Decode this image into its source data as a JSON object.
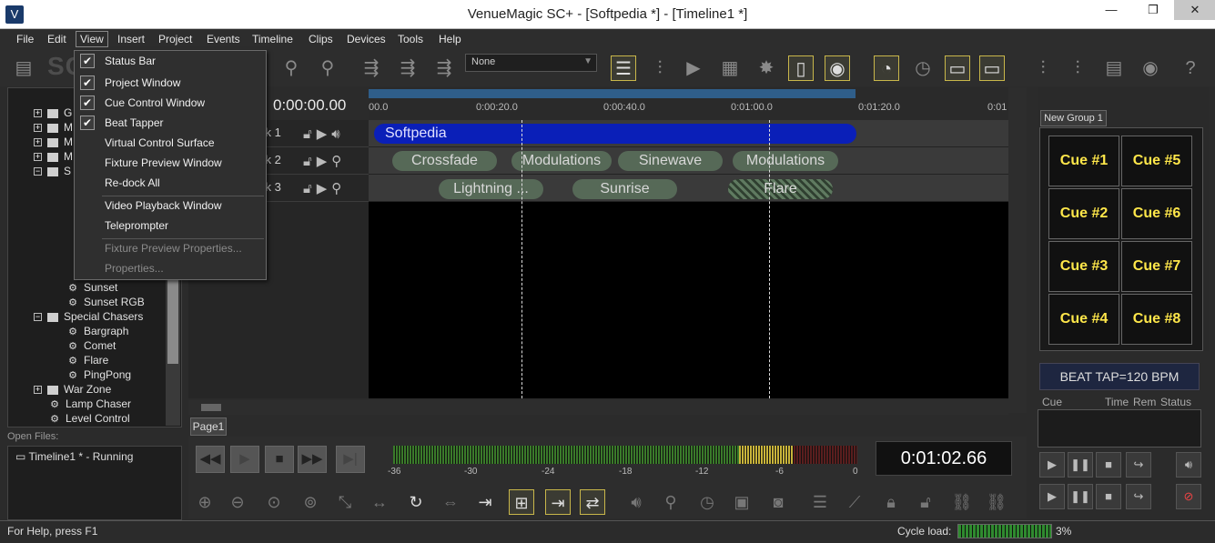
{
  "titlebar": {
    "title": "VenueMagic SC+ - [Softpedia *] - [Timeline1 *]",
    "minimize": "—",
    "restore": "❐",
    "close": "✕"
  },
  "menubar": [
    "File",
    "Edit",
    "View",
    "Insert",
    "Project",
    "Events",
    "Timeline",
    "Clips",
    "Devices",
    "Tools",
    "Help"
  ],
  "watermark": "SOFTPEDIA",
  "toolbar": {
    "select_value": "None"
  },
  "view_menu": {
    "items": [
      {
        "label": "Status Bar",
        "checked": true
      },
      {
        "label": "Project Window",
        "checked": true
      },
      {
        "label": "Cue Control Window",
        "checked": true
      },
      {
        "label": "Beat Tapper",
        "checked": true
      },
      {
        "label": "Virtual Control Surface"
      },
      {
        "label": "Fixture Preview Window"
      },
      {
        "label": "Re-dock All"
      },
      {
        "label": "Video Playback Window"
      },
      {
        "label": "Teleprompter"
      },
      {
        "label": "Fixture Preview Properties..."
      },
      {
        "label": "Properties..."
      }
    ]
  },
  "tree": {
    "items": [
      {
        "label": "G"
      },
      {
        "label": "M"
      },
      {
        "label": "M"
      },
      {
        "label": "M"
      },
      {
        "label": "S"
      },
      {
        "label": "Sunset"
      },
      {
        "label": "Sunset RGB"
      },
      {
        "label": "Special Chasers"
      },
      {
        "label": "Bargraph"
      },
      {
        "label": "Comet"
      },
      {
        "label": "Flare"
      },
      {
        "label": "PingPong"
      },
      {
        "label": "War Zone"
      },
      {
        "label": "Lamp Chaser"
      },
      {
        "label": "Level Control"
      }
    ]
  },
  "open_files": {
    "label": "Open Files:",
    "file": "Timeline1 * - Running"
  },
  "timeline": {
    "timecode": "0:00:00.00",
    "ruler_ticks": [
      "00.0",
      "0:00:20.0",
      "0:00:40.0",
      "0:01:00.0",
      "0:01:20.0",
      "0:01"
    ],
    "tracks": [
      {
        "name": "ck 1",
        "clips": [
          {
            "label": "Softpedia",
            "style": "blue"
          }
        ]
      },
      {
        "name": "ck 2",
        "clips": [
          {
            "label": "Crossfade"
          },
          {
            "label": "Modulations"
          },
          {
            "label": "Sinewave"
          },
          {
            "label": "Modulations"
          }
        ]
      },
      {
        "name": "ck 3",
        "clips": [
          {
            "label": "Lightning ..."
          },
          {
            "label": "Sunrise"
          },
          {
            "label": "Flare",
            "style": "hatch"
          }
        ]
      }
    ],
    "page_tab": "Page1"
  },
  "transport": {
    "meter_labels": [
      "-36",
      "-30",
      "-24",
      "-18",
      "-12",
      "-6",
      "0"
    ],
    "clock": "0:01:02.66"
  },
  "cue_panel": {
    "group_tab": "New Group 1",
    "cues": [
      "Cue #1",
      "Cue #2",
      "Cue #3",
      "Cue #4",
      "Cue #5",
      "Cue #6",
      "Cue #7",
      "Cue #8"
    ],
    "beat_tap": "BEAT TAP=120 BPM",
    "list_headers": [
      "Cue",
      "Time",
      "Rem",
      "Status"
    ]
  },
  "statusbar": {
    "help": "For Help, press F1",
    "cycle_label": "Cycle load:",
    "cycle_load": 0.03,
    "cycle_pct": "3%"
  },
  "colors": {
    "accent_yellow": "#ffe74a",
    "clip_green": "#566957",
    "clip_blue": "#0a1fb8",
    "selected_border": "#c9b74a"
  }
}
